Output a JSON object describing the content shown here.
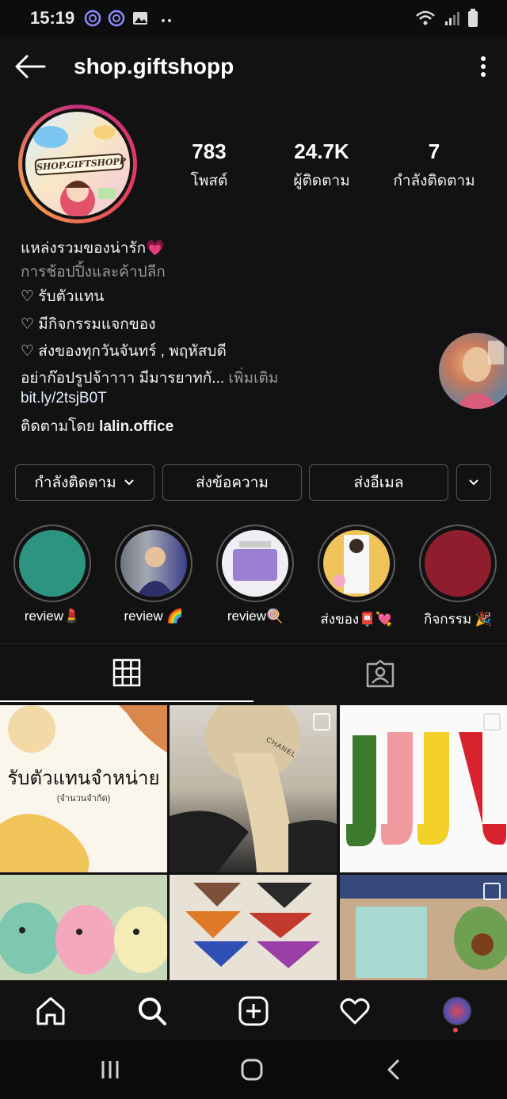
{
  "status_bar": {
    "time": "15:19",
    "icons": [
      "viber-icon",
      "viber-icon",
      "image-icon",
      "more-dots-icon"
    ],
    "right_icons": [
      "wifi-icon",
      "signal-icon",
      "battery-icon"
    ]
  },
  "header": {
    "username": "shop.giftshopp"
  },
  "avatar": {
    "logo_text": "SHOP.GIFTSHOPP"
  },
  "stats": [
    {
      "value": "783",
      "label": "โพสต์"
    },
    {
      "value": "24.7K",
      "label": "ผู้ติดตาม"
    },
    {
      "value": "7",
      "label": "กำลังติดตาม"
    }
  ],
  "bio": {
    "name": "แหล่งรวมของน่ารัก💗",
    "category": "การช้อปปิ้งและค้าปลีก",
    "line1": "♡ รับตัวแทน",
    "line2": "♡ มีกิจกรรมแจกของ",
    "line3": "♡ ส่งของทุกวันจันทร์ , พฤหัสบดี",
    "line4": "อย่าก๊อปรูปจ้าาาา มีมารยาทกั...",
    "more": "เพิ่มเติม",
    "link": "bit.ly/2tsjB0T",
    "followed_prefix": "ติดตามโดย",
    "followed_by": "lalin.office"
  },
  "buttons": {
    "following": "กำลังติดตาม",
    "message": "ส่งข้อความ",
    "email": "ส่งอีเมล"
  },
  "highlights": [
    {
      "label": "review💄",
      "color": "#2e9482"
    },
    {
      "label": "review 🌈",
      "color": "#8a8f99"
    },
    {
      "label": "review🍭",
      "color": "#c9bfe0"
    },
    {
      "label": "ส่งของ📮💘",
      "color": "#f0c45a"
    },
    {
      "label": "กิจกรรม 🎉",
      "color": "#8e1d2e"
    }
  ],
  "posts": [
    {
      "text": "รับตัวแทนจำหน่าย",
      "subtext": "(จำนวนจำกัด)"
    },
    {
      "text": "CHANEL"
    },
    {
      "text": ""
    },
    {
      "text": ""
    },
    {
      "text": ""
    },
    {
      "text": ""
    }
  ],
  "colors": {
    "background": "#121212",
    "story_ring": "#c6307e",
    "button_border": "#555555"
  }
}
